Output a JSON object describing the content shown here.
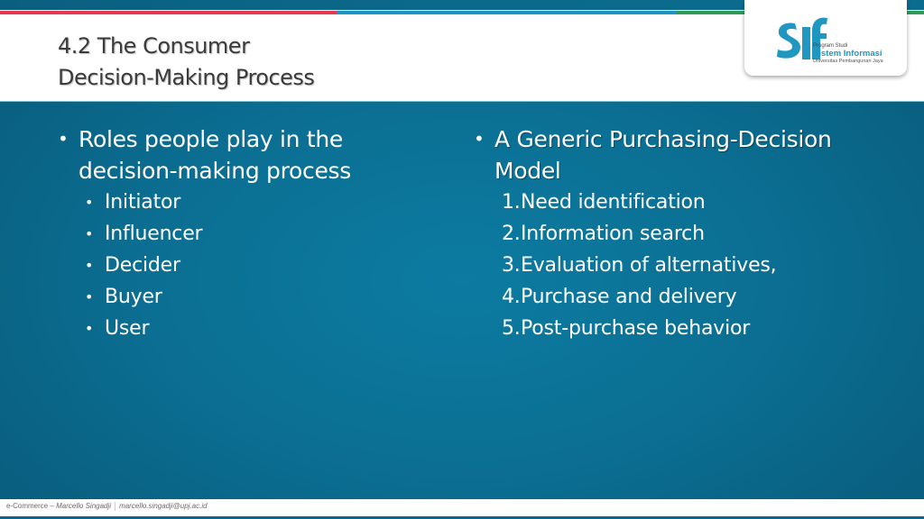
{
  "slide": {
    "title": "4.2 The Consumer\nDecision-Making Process",
    "colors": {
      "accent_red": "#e8384f",
      "accent_blue": "#1b93c3",
      "accent_green": "#2e9a56",
      "background": "#0b6f93",
      "title_text": "#3b3b3b"
    }
  },
  "logo": {
    "mark": "SIf",
    "line1": "Program Studi",
    "line2": "Sistem Informasi",
    "line3": "Universitas Pembangunan Jaya"
  },
  "left_column": {
    "heading": "Roles people play in the decision-making process",
    "items": [
      "Initiator",
      "Influencer",
      "Decider",
      "Buyer",
      "User"
    ]
  },
  "right_column": {
    "heading": "A Generic Purchasing-Decision Model",
    "steps": [
      {
        "number": "1.",
        "label": "Need identification"
      },
      {
        "number": "2.",
        "label": "Information search"
      },
      {
        "number": "3.",
        "label": "Evaluation of alternatives,"
      },
      {
        "number": "4.",
        "label": "Purchase and delivery"
      },
      {
        "number": "5.",
        "label": "Post-purchase behavior"
      }
    ]
  },
  "footer": {
    "course": "e-Commerce",
    "dash": " – ",
    "author": "Marcello Singadji",
    "email": "marcello.singadji@upj.ac.id"
  },
  "icons": {
    "bullet": "•"
  }
}
